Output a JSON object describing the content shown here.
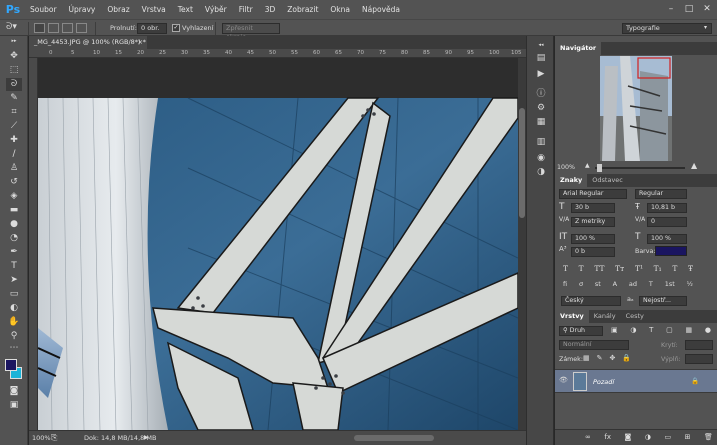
{
  "app": {
    "logo": "Ps",
    "menu": [
      "Soubor",
      "Úpravy",
      "Obraz",
      "Vrstva",
      "Text",
      "Výběr",
      "Filtr",
      "3D",
      "Zobrazit",
      "Okna",
      "Nápověda"
    ],
    "window_controls": {
      "minimize": "–",
      "maximize": "□",
      "close": "✕"
    }
  },
  "options": {
    "feather_label": "Prolnutí:",
    "feather_value": "0 obr.",
    "antialias_label": "Vyhlazení",
    "refine_edge": "Zpřesnit okraje...",
    "workspace": "Typografie"
  },
  "document": {
    "tab_title": "_MG_4453.JPG @ 100% (RGB/8*) *",
    "tab_close": "×",
    "zoom": "100%",
    "doc_info": "Dok: 14,8 MB/14,8 MB",
    "ruler_marks": [
      "0",
      "5",
      "10",
      "15",
      "20",
      "25",
      "30",
      "35",
      "40",
      "45",
      "50",
      "55",
      "60",
      "65",
      "70",
      "75",
      "80",
      "85",
      "90",
      "95",
      "100",
      "105"
    ]
  },
  "navigator": {
    "tab": "Navigátor",
    "zoom": "100%"
  },
  "character": {
    "tabs": [
      "Znaky",
      "Odstavec"
    ],
    "font_family": "Arial Regular",
    "font_style": "Regular",
    "font_size": "30 b",
    "leading": "10,81 b",
    "kerning": "Z metriky",
    "tracking": "0",
    "vscale": "100 %",
    "hscale": "100 %",
    "baseline": "0 b",
    "color_label": "Barva:",
    "color": "#1a1560",
    "type_buttons": [
      "T",
      "T",
      "TT",
      "Tт",
      "T¹",
      "T₁",
      "T",
      "Ŧ"
    ],
    "opentype_buttons": [
      "fi",
      "ơ",
      "st",
      "A",
      "ad",
      "T",
      "1st",
      "½"
    ],
    "language": "Český",
    "aa_icon": "aₐ",
    "antialias": "Nejostř..."
  },
  "layers": {
    "tabs": [
      "Vrstvy",
      "Kanály",
      "Cesty"
    ],
    "filter": "Druh",
    "blend_mode": "Normální",
    "opacity_label": "Krytí:",
    "lock_label": "Zámek:",
    "fill_label": "Výplň:",
    "layer_name": "Pozadí",
    "eye": "👁",
    "lock": "🔒"
  }
}
